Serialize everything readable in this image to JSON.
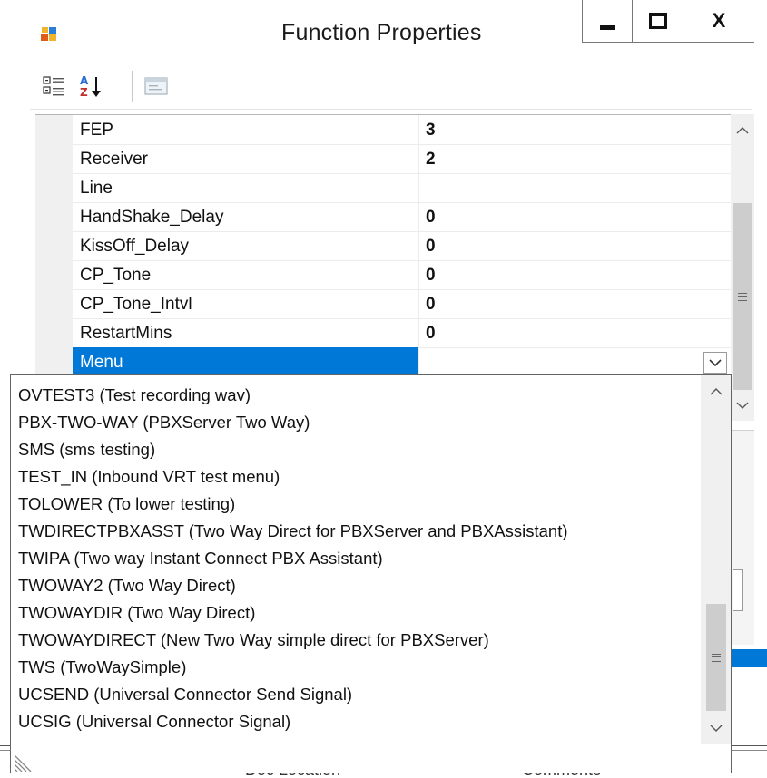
{
  "window": {
    "title": "Function Properties",
    "close_label": "X"
  },
  "toolbar": {
    "categorized_icon": "categorized-view-icon",
    "alphabetical_icon": "alphabetical-sort-icon",
    "property_pages_icon": "property-pages-icon"
  },
  "grid": {
    "rows": [
      {
        "name": "FEP",
        "value": "3"
      },
      {
        "name": "Receiver",
        "value": "2"
      },
      {
        "name": "Line",
        "value": ""
      },
      {
        "name": "HandShake_Delay",
        "value": "0"
      },
      {
        "name": "KissOff_Delay",
        "value": "0"
      },
      {
        "name": "CP_Tone",
        "value": "0"
      },
      {
        "name": "CP_Tone_Intvl",
        "value": "0"
      },
      {
        "name": "RestartMins",
        "value": "0"
      },
      {
        "name": "Menu",
        "value": ""
      }
    ],
    "selected_index": 8
  },
  "dropdown": {
    "items": [
      "OVTEST3 (Test recording wav)",
      "PBX-TWO-WAY (PBXServer Two Way)",
      "SMS (sms testing)",
      "TEST_IN (Inbound VRT test menu)",
      "TOLOWER (To lower testing)",
      "TWDIRECTPBXASST (Two Way Direct for PBXServer and PBXAssistant)",
      "TWIPA (Two way Instant Connect PBX Assistant)",
      "TWOWAY2 (Two Way Direct)",
      "TWOWAYDIR (Two Way Direct)",
      "TWOWAYDIRECT (New Two Way simple direct for PBXServer)",
      "TWS (TwoWaySimple)",
      "UCSEND (Universal Connector Send Signal)",
      "UCSIG (Universal Connector Signal)"
    ]
  },
  "background": {
    "fragment_1": "Doc Location",
    "fragment_2": "Comments"
  },
  "colors": {
    "selection": "#0078d7",
    "scroll_track": "#f0f0f0",
    "scroll_thumb": "#cdcdcd"
  }
}
